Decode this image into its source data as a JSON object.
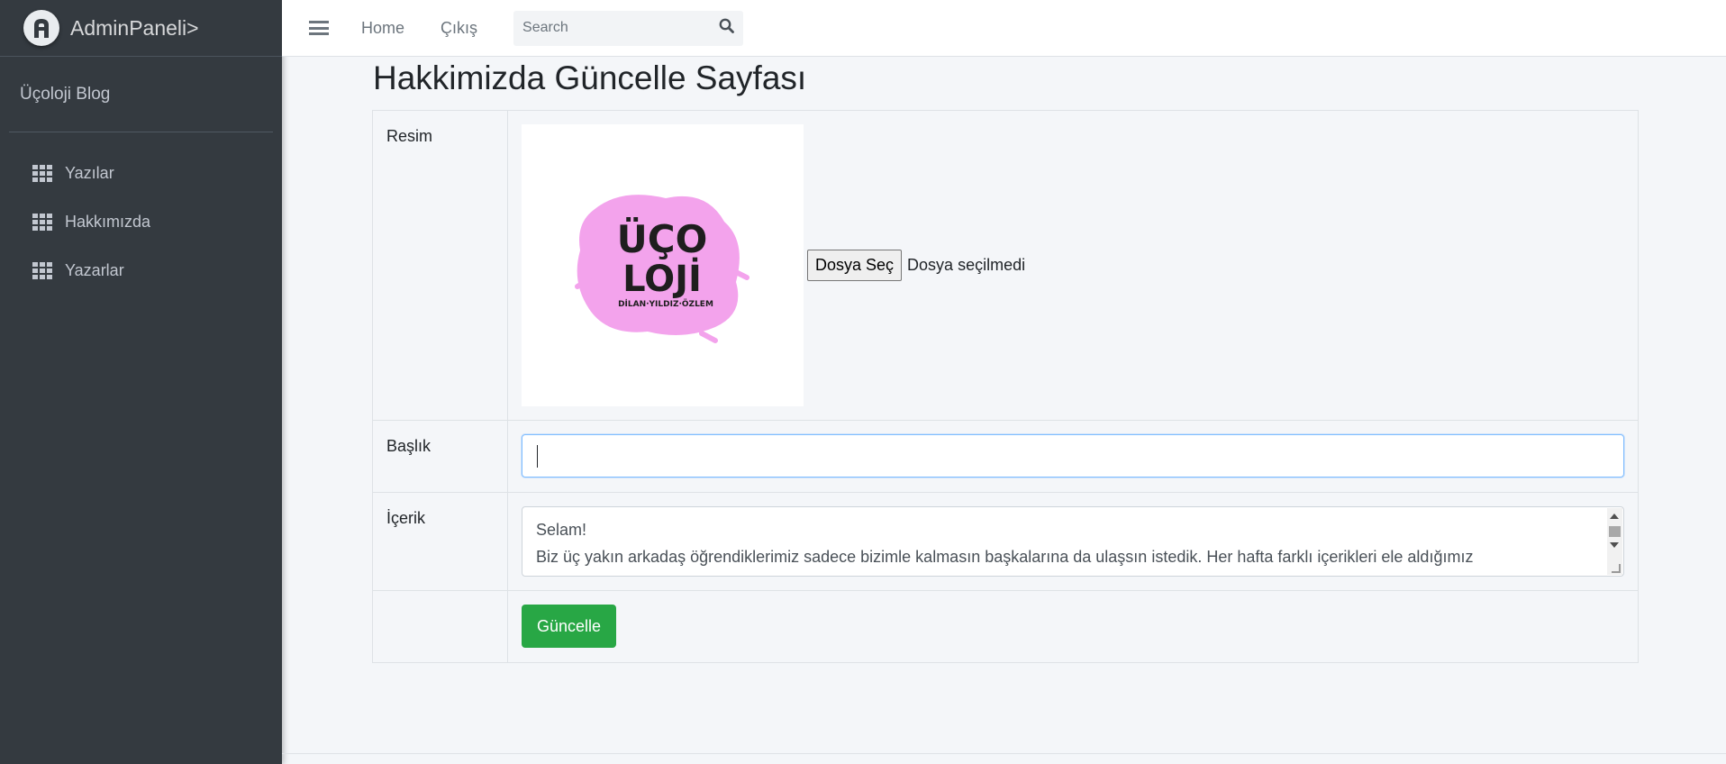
{
  "sidebar": {
    "brand": "AdminPaneli>",
    "user_name": "Üçoloji Blog",
    "items": [
      {
        "label": "Yazılar",
        "icon": "grid-icon"
      },
      {
        "label": "Hakkımızda",
        "icon": "grid-icon"
      },
      {
        "label": "Yazarlar",
        "icon": "grid-icon"
      }
    ]
  },
  "topbar": {
    "home": "Home",
    "logout": "Çıkış",
    "search_placeholder": "Search"
  },
  "main": {
    "title": "Hakkimizda Güncelle Sayfası",
    "image_label": "Resim",
    "logo_line1": "ÜÇO",
    "logo_line2": "LOJİ",
    "logo_sub": "DİLAN·YILDIZ·ÖZLEM",
    "file_button": "Dosya Seç",
    "file_status": "Dosya seçilmedi",
    "title_label": "Başlık",
    "title_value": "",
    "content_label": "İçerik",
    "content_line1": "Selam!",
    "content_line2": "Biz üç yakın arkadaş öğrendiklerimiz sadece bizimle kalmasın başkalarına da ulaşsın istedik. Her hafta farklı içerikleri ele aldığımız",
    "update_button": "Güncelle"
  },
  "colors": {
    "sidebar_bg": "#343a40",
    "accent_green": "#28a745",
    "logo_pink": "#f3a3ec"
  }
}
